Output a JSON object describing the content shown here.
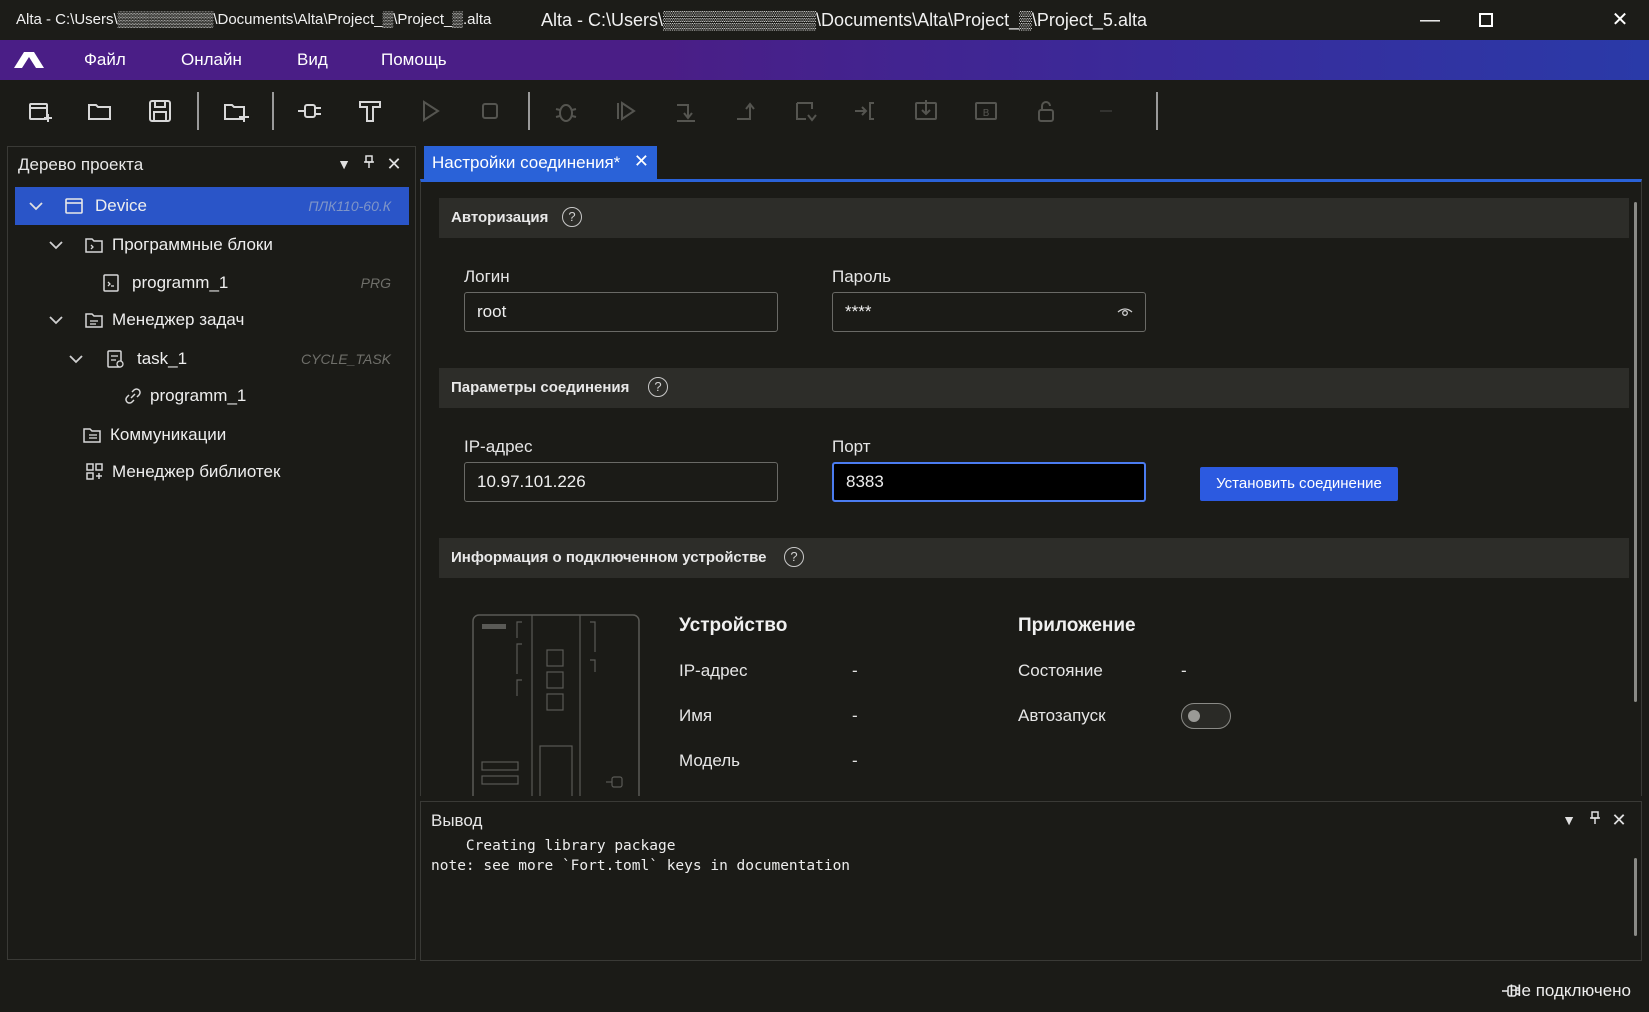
{
  "window": {
    "small_title": "Alta - C:\\Users\\▒▒▒▒▒▒▒▒▒\\Documents\\Alta\\Project_▒\\Project_▒.alta",
    "main_title": "Alta - C:\\Users\\▒▒▒▒▒▒▒▒▒▒▒▒\\Documents\\Alta\\Project_▒\\Project_5.alta",
    "minimize": "—",
    "maximize": "□",
    "close": "✕"
  },
  "menu": {
    "items": [
      "Файл",
      "Онлайн",
      "Вид",
      "Помощь"
    ]
  },
  "toolbar": {
    "icons": [
      "new-project-icon",
      "open-folder-icon",
      "save-icon",
      "add-device-icon",
      "connect-plug-icon",
      "build-icon",
      "run-icon",
      "stop-icon",
      "debug-icon",
      "step-run-icon",
      "step-over-icon",
      "step-out-icon",
      "step-into-icon",
      "goto-icon",
      "download-icon",
      "upload-icon",
      "lock-icon",
      "extra-icon"
    ]
  },
  "project_tree": {
    "title": "Дерево проекта",
    "items": [
      {
        "label": "Device",
        "type": "ПЛК110-60.К"
      },
      {
        "label": "Программные блоки",
        "type": ""
      },
      {
        "label": "programm_1",
        "type": "PRG"
      },
      {
        "label": "Менеджер задач",
        "type": ""
      },
      {
        "label": "task_1",
        "type": "CYCLE_TASK"
      },
      {
        "label": "programm_1",
        "type": ""
      },
      {
        "label": "Коммуникации",
        "type": ""
      },
      {
        "label": "Менеджер библиотек",
        "type": ""
      }
    ]
  },
  "tab": {
    "label": "Настройки соединения*",
    "close": "✕"
  },
  "auth": {
    "title": "Авторизация",
    "help": "?",
    "login_label": "Логин",
    "login_value": "root",
    "password_label": "Пароль",
    "password_value": "****"
  },
  "connection": {
    "title": "Параметры соединения",
    "help": "?",
    "ip_label": "IP-адрес",
    "ip_value": "10.97.101.226",
    "port_label": "Порт",
    "port_value": "8383",
    "connect_button": "Установить соединение"
  },
  "device_info": {
    "title": "Информация о подключенном устройстве",
    "help": "?",
    "device_col_title": "Устройство",
    "device_rows": [
      {
        "key": "IP-адрес",
        "value": "-"
      },
      {
        "key": "Имя",
        "value": "-"
      },
      {
        "key": "Модель",
        "value": "-"
      }
    ],
    "app_col_title": "Приложение",
    "app_state_key": "Состояние",
    "app_state_value": "-",
    "autostart_key": "Автозапуск",
    "autostart_on": false
  },
  "output": {
    "title": "Вывод",
    "log": "    Creating library package\nnote: see more `Fort.toml` keys in documentation"
  },
  "status": {
    "text": "Не подключено"
  },
  "colors": {
    "accent": "#2a62d8",
    "menu_gradient_start": "#4a1e86",
    "menu_gradient_end": "#2a3aa8",
    "background": "#1b1b17"
  }
}
